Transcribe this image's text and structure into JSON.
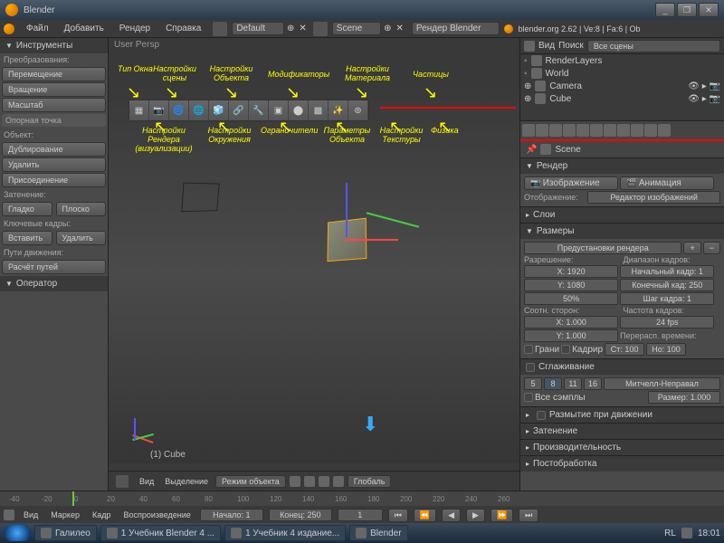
{
  "title": "Blender",
  "version_info": "blender.org 2.62 | Ve:8 | Fa:6 | Ob",
  "render_tag": "Рендер Blender",
  "topmenu": [
    "Файл",
    "Добавить",
    "Рендер",
    "Справка"
  ],
  "layout": "Default",
  "scene": "Scene",
  "left_panel": {
    "header": "Инструменты",
    "s1": "Преобразования:",
    "b1": "Перемещение",
    "b2": "Вращение",
    "b3": "Масштаб",
    "s2": "Опорная точка",
    "s3": "Объект:",
    "b4": "Дублирование",
    "b5": "Удалить",
    "b6": "Присоединение",
    "s4": "Затенение:",
    "b7": "Гладко",
    "b8": "Плоско",
    "s5": "Ключевые кадры:",
    "b9": "Вставить",
    "b10": "Удалить",
    "s6": "Пути движения:",
    "b11": "Расчёт путей",
    "s7": "Оператор"
  },
  "viewport": {
    "persp": "User Persp",
    "cube": "(1) Cube",
    "footer": {
      "view": "Вид",
      "select": "Выделение",
      "mode": "Режим объекта",
      "global": "Глобаль"
    }
  },
  "annotations": {
    "a1": "Тип Окна",
    "a2": "Настройки сцены",
    "a3": "Настройки Объекта",
    "a4": "Модификаторы",
    "a5": "Настройки Материала",
    "a6": "Частицы",
    "b1": "Настройки Рендера (визуализации)",
    "b2": "Настройки Окружения",
    "b3": "Ограничители",
    "b4": "Параметры Объекта",
    "b5": "Настройки Текстуры",
    "b6": "Физика"
  },
  "outliner": {
    "header": {
      "view": "Вид",
      "search": "Поиск",
      "filter": "Все сцены"
    },
    "items": [
      "RenderLayers",
      "World",
      "Camera",
      "Cube"
    ]
  },
  "crumb": "Scene",
  "props": {
    "render": "Рендер",
    "img_btn": "Изображение",
    "anim_btn": "Анимация",
    "display": "Отображение:",
    "display_val": "Редактор изображений",
    "layers": "Слои",
    "dims": "Размеры",
    "preset": "Предустановки рендера",
    "resolution": "Разрешение:",
    "x": "X: 1920",
    "y": "Y: 1080",
    "pct": "50%",
    "frame_range": "Диапазон кадров:",
    "start": "Начальный кадр: 1",
    "end": "Конечный кад: 250",
    "step": "Шаг кадра: 1",
    "aspect": "Соотн. сторон:",
    "ax": "X: 1.000",
    "ay": "Y: 1.000",
    "fps": "Частота кадров:",
    "fps_val": "24 fps",
    "remap": "Перерасп. времени:",
    "old": "Ст: 100",
    "new": "Но: 100",
    "border": "Грани",
    "crop": "Кадрир",
    "aa": "Сглаживание",
    "samples": [
      "5",
      "8",
      "11",
      "16"
    ],
    "filter": "Митчелл-Неправал",
    "full": "Все сэмплы",
    "size": "Размер: 1.000",
    "mblur": "Размытие при движении",
    "shading": "Затенение",
    "perf": "Производительность",
    "post": "Постобработка"
  },
  "timeline": {
    "ticks": [
      "-40",
      "-20",
      "0",
      "20",
      "40",
      "60",
      "80",
      "100",
      "120",
      "140",
      "160",
      "180",
      "200",
      "220",
      "240",
      "260"
    ],
    "menu": [
      "Вид",
      "Маркер",
      "Кадр",
      "Воспроизведение"
    ],
    "start": "Начало: 1",
    "end": "Конец: 250",
    "cur": "1"
  },
  "taskbar": {
    "items": [
      "Галилео",
      "1 Учебник Blender 4 ...",
      "1 Учебник 4 издание...",
      "Blender"
    ],
    "time": "18:01",
    "lang": "RL"
  }
}
